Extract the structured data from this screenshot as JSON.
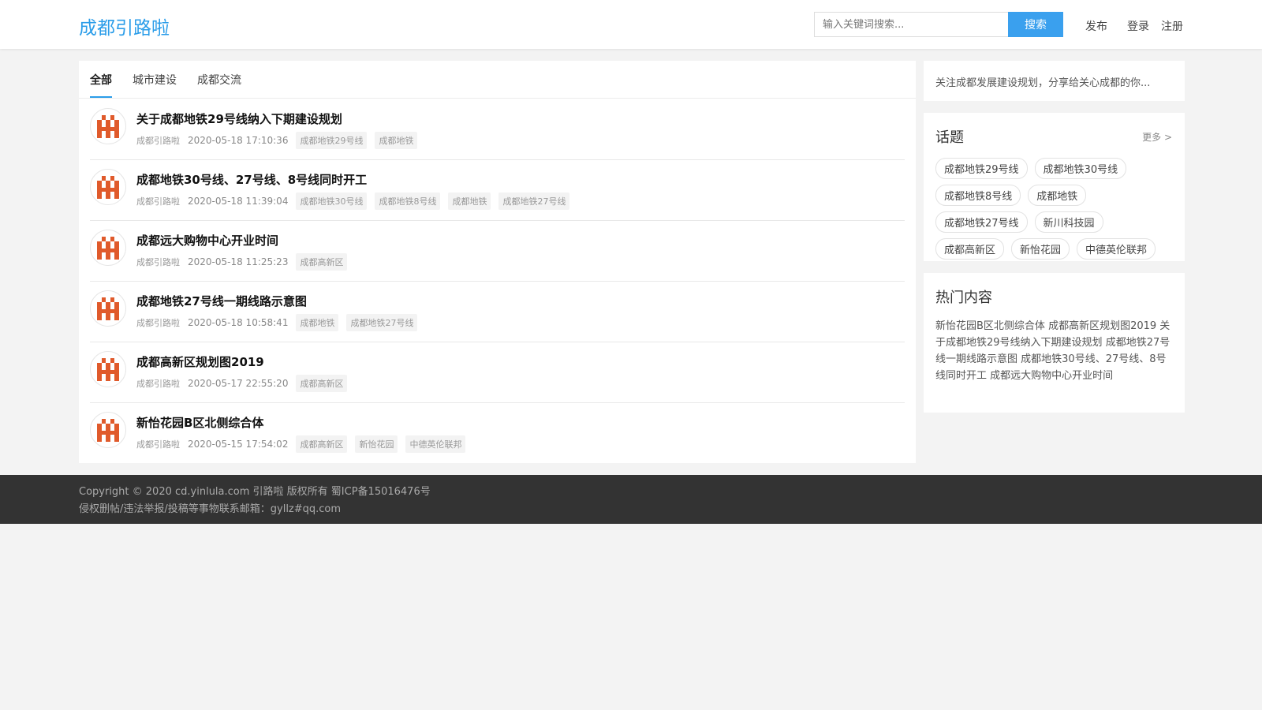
{
  "site": {
    "brand": "成都引路啦"
  },
  "header": {
    "search_placeholder": "输入关键词搜索...",
    "search_button": "搜索",
    "publish": "发布",
    "login": "登录",
    "register": "注册"
  },
  "tabs": [
    "全部",
    "城市建设",
    "成都交流"
  ],
  "posts": [
    {
      "title": "关于成都地铁29号线纳入下期建设规划",
      "author": "成都引路啦",
      "time": "2020-05-18 17:10:36",
      "tags": [
        "成都地铁29号线",
        "成都地铁"
      ]
    },
    {
      "title": "成都地铁30号线、27号线、8号线同时开工",
      "author": "成都引路啦",
      "time": "2020-05-18 11:39:04",
      "tags": [
        "成都地铁30号线",
        "成都地铁8号线",
        "成都地铁",
        "成都地铁27号线"
      ]
    },
    {
      "title": "成都远大购物中心开业时间",
      "author": "成都引路啦",
      "time": "2020-05-18 11:25:23",
      "tags": [
        "成都高新区"
      ]
    },
    {
      "title": "成都地铁27号线一期线路示意图",
      "author": "成都引路啦",
      "time": "2020-05-18 10:58:41",
      "tags": [
        "成都地铁",
        "成都地铁27号线"
      ]
    },
    {
      "title": "成都高新区规划图2019",
      "author": "成都引路啦",
      "time": "2020-05-17 22:55:20",
      "tags": [
        "成都高新区"
      ]
    },
    {
      "title": "新怡花园B区北侧综合体",
      "author": "成都引路啦",
      "time": "2020-05-15 17:54:02",
      "tags": [
        "成都高新区",
        "新怡花园",
        "中德英伦联邦"
      ]
    }
  ],
  "sidebar": {
    "description": "关注成都发展建设规划，分享给关心成都的你...",
    "topics_title": "话题",
    "more": "更多 >",
    "topics": [
      "成都地铁29号线",
      "成都地铁30号线",
      "成都地铁8号线",
      "成都地铁",
      "成都地铁27号线",
      "新川科技园",
      "成都高新区",
      "新怡花园",
      "中德英伦联邦"
    ],
    "hot_title": "热门内容",
    "hot_items": [
      "新怡花园B区北侧综合体",
      "成都高新区规划图2019",
      "关于成都地铁29号线纳入下期建设规划",
      "成都地铁27号线一期线路示意图",
      "成都地铁30号线、27号线、8号线同时开工",
      "成都远大购物中心开业时间"
    ]
  },
  "footer": {
    "copyright": "Copyright © 2020 cd.yinlula.com 引路啦 版权所有 蜀ICP备15016476号",
    "contact": "侵权删帖/违法举报/投稿等事物联系邮箱：gyllz#qq.com"
  },
  "colors": {
    "accent": "#2b9de9",
    "avatar_logo": "#e05a2b",
    "footer_bg": "#333333"
  },
  "icons": {
    "avatar": "site-logo-icon"
  }
}
